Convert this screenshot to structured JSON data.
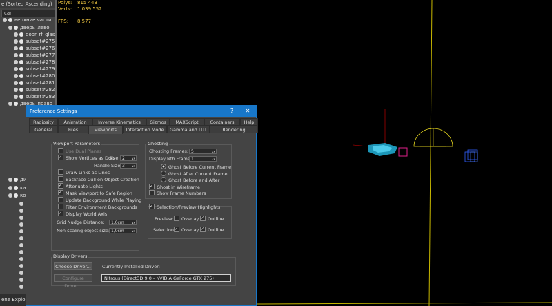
{
  "explorer": {
    "sort_label": "e (Sorted Ascending)",
    "filter": "car",
    "rows": [
      {
        "label": "верхние части"
      },
      {
        "label": "дверь_лево"
      },
      {
        "label": "door_rf_glas"
      },
      {
        "label": "subset#275"
      },
      {
        "label": "subset#276"
      },
      {
        "label": "subset#277"
      },
      {
        "label": "subset#278"
      },
      {
        "label": "subset#279"
      },
      {
        "label": "subset#280"
      },
      {
        "label": "subset#281"
      },
      {
        "label": "subset#282"
      },
      {
        "label": "subset#283"
      },
      {
        "label": "дверь_право"
      },
      {
        "label": "дина"
      },
      {
        "label": "карб"
      },
      {
        "label": "коле"
      }
    ],
    "footer": "ene Explorer"
  },
  "viewport": {
    "polys_label": "Polys:",
    "polys_value": "815 443",
    "verts_label": "Verts:",
    "verts_value": "1 039 552",
    "fps_label": "FPS:",
    "fps_value": "8,577",
    "colors": {
      "stats": "#f1c842",
      "object": "#2ab0d8",
      "helper_yellow": "#f0e020",
      "selection": "#e0208a",
      "blue_box": "#3060ff"
    }
  },
  "dialog": {
    "title": "Preference Settings",
    "help_symbol": "?",
    "close_symbol": "✕",
    "tabs_row1": [
      "Radiosity",
      "Animation",
      "Inverse Kinematics",
      "Gizmos",
      "MAXScript",
      "Containers",
      "Help"
    ],
    "tabs_row2": [
      "General",
      "Files",
      "Viewports",
      "Interaction Mode",
      "Gamma and LUT",
      "Rendering"
    ],
    "active_tab": "Viewports",
    "viewport_params": {
      "title": "Viewport Parameters",
      "use_dual_planes": "Use Dual Planes",
      "show_vertices": "Show Vertices as Dots",
      "size_label": "Size:",
      "size_value": "2",
      "handle_size_label": "Handle Size:",
      "handle_size_value": "3",
      "draw_links": "Draw Links as Lines",
      "backface_cull": "Backface Cull on Object Creation",
      "attenuate_lights": "Attenuate Lights",
      "mask_viewport": "Mask Viewport to Safe Region",
      "update_background": "Update Background While Playing",
      "filter_env": "Filter Environment Backgrounds",
      "display_world_axis": "Display World Axis",
      "grid_nudge_label": "Grid Nudge Distance:",
      "grid_nudge_value": "1,0cm",
      "non_scaling_label": "Non-scaling object size:",
      "non_scaling_value": "1,0cm"
    },
    "ghosting": {
      "title": "Ghosting",
      "frames_label": "Ghosting Frames:",
      "frames_value": "5",
      "nth_label": "Display Nth Frame:",
      "nth_value": "1",
      "before": "Ghost Before Current Frame",
      "after": "Ghost After Current Frame",
      "both": "Ghost Before and After",
      "wireframe": "Ghost in Wireframe",
      "frame_numbers": "Show Frame Numbers"
    },
    "selection": {
      "title": "Selection/Preview Highlights",
      "preview_label": "Preview:",
      "selection_label": "Selection:",
      "overlay": "Overlay",
      "outline": "Outline"
    },
    "drivers": {
      "title": "Display Drivers",
      "choose_btn": "Choose Driver...",
      "configure_btn": "Configure Driver...",
      "installed_label": "Currently Installed Driver:",
      "installed_value": "Nitrous (Direct3D 9.0 - NVIDIA GeForce GTX 275)"
    }
  }
}
